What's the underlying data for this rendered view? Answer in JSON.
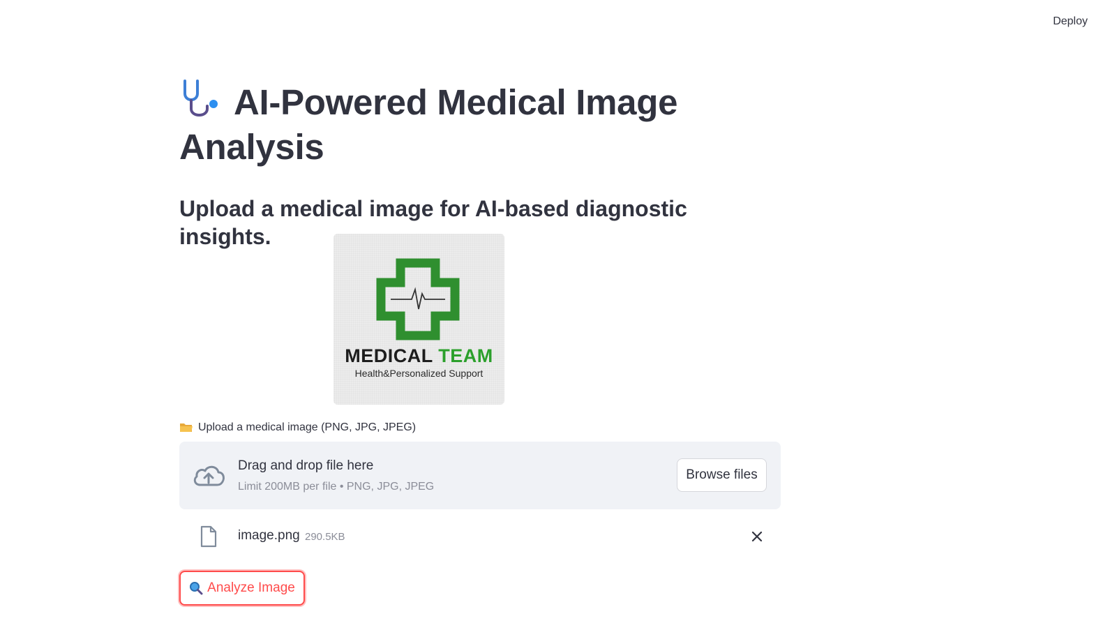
{
  "header": {
    "deploy_label": "Deploy"
  },
  "main": {
    "title": "AI-Powered Medical Image Analysis",
    "subtitle": "Upload a medical image for AI-based diagnostic insights.",
    "logo": {
      "line1_a": "MEDICAL",
      "line1_b": "TEAM",
      "line2": "Health&Personalized Support"
    },
    "uploader": {
      "label": "Upload a medical image (PNG, JPG, JPEG)",
      "drop_title": "Drag and drop file here",
      "drop_subtitle": "Limit 200MB per file • PNG, JPG, JPEG",
      "browse_label": "Browse files"
    },
    "file": {
      "name": "image.png",
      "size": "290.5KB"
    },
    "analyze_label": "Analyze Image"
  },
  "colors": {
    "accent": "#ff4b4b",
    "text": "#31333f",
    "muted": "#8b8d98",
    "dropzone_bg": "#f0f2f6",
    "logo_green": "#2ca02c"
  }
}
